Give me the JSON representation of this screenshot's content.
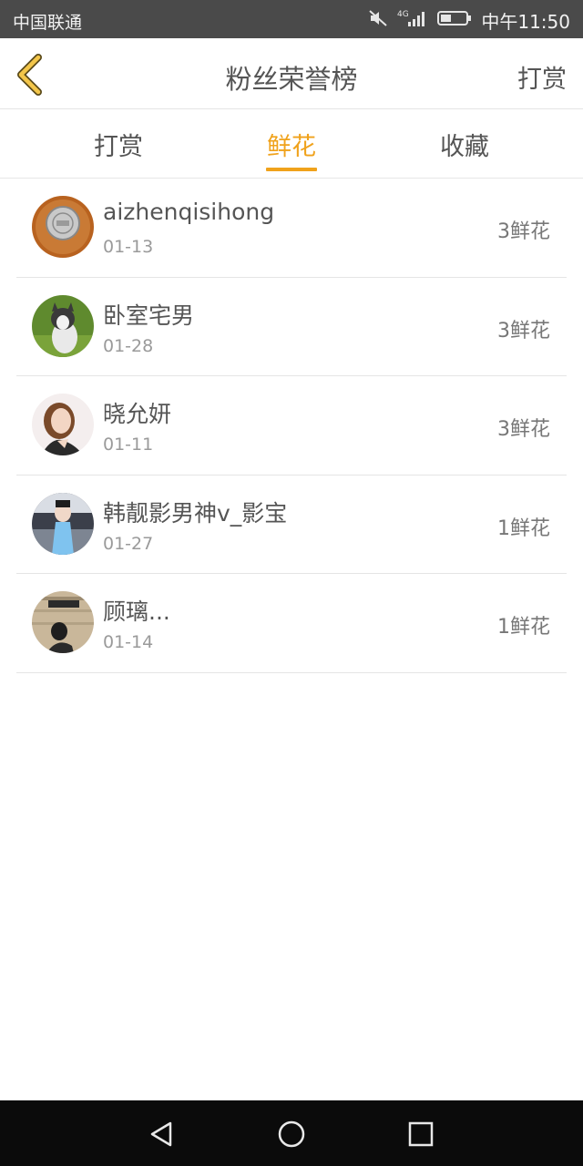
{
  "status_bar": {
    "carrier": "中国联通",
    "network": "4G",
    "time": "中午11:50",
    "icons": [
      "mute-icon",
      "signal-icon",
      "battery-icon"
    ]
  },
  "header": {
    "title": "粉丝荣誉榜",
    "action_label": "打赏",
    "back_icon": "chevron-left-icon"
  },
  "tabs": [
    {
      "label": "打赏",
      "active": false
    },
    {
      "label": "鲜花",
      "active": true
    },
    {
      "label": "收藏",
      "active": false
    }
  ],
  "list": [
    {
      "name": "aizhenqisihong",
      "date": "01-13",
      "count": "3鲜花"
    },
    {
      "name": "卧室宅男",
      "date": "01-28",
      "count": "3鲜花"
    },
    {
      "name": "晓允妍",
      "date": "01-11",
      "count": "3鲜花"
    },
    {
      "name": "韩靓影男神v_影宝",
      "date": "01-27",
      "count": "1鲜花"
    },
    {
      "name": "顾璃...",
      "date": "01-14",
      "count": "1鲜花"
    }
  ],
  "navbar": {
    "icons": [
      "back-triangle-icon",
      "home-circle-icon",
      "recent-square-icon"
    ]
  },
  "colors": {
    "accent": "#f0a21b",
    "status_bar": "#4a4a4a",
    "nav_bar": "#0b0b0b"
  }
}
